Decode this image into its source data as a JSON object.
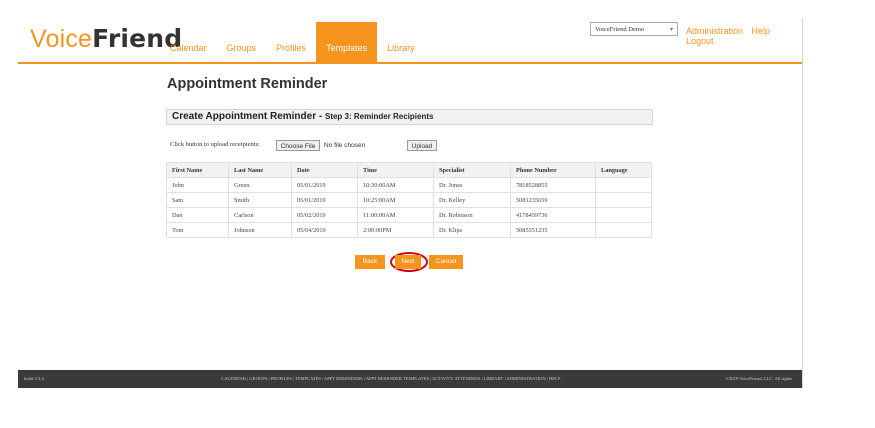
{
  "logo": {
    "voice": "Voice",
    "friend": "Friend"
  },
  "nav": {
    "tabs": [
      {
        "label": "Calendar",
        "active": false
      },
      {
        "label": "Groups",
        "active": false
      },
      {
        "label": "Profiles",
        "active": false
      },
      {
        "label": "Templates",
        "active": true
      },
      {
        "label": "Library",
        "active": false
      }
    ]
  },
  "account": {
    "selected": "VoiceFriend Demo"
  },
  "top_links": {
    "administration": "Administration",
    "help": "Help",
    "logout": "Logout"
  },
  "page": {
    "title": "Appointment Reminder"
  },
  "step": {
    "main": "Create Appointment Reminder - ",
    "sub": "Step 3: Reminder Recipients"
  },
  "upload": {
    "label": "Click button to upload receipients:",
    "choose_label": "Choose File",
    "file_status": "No file chosen",
    "upload_label": "Upload"
  },
  "table": {
    "headers": [
      "First Name",
      "Last Name",
      "Date",
      "Time",
      "Specialist",
      "Phone Number",
      "Language"
    ],
    "rows": [
      [
        "John",
        "Green",
        "05/01/2019",
        "10:30:00AM",
        "Dr. Jones",
        "7818528855",
        ""
      ],
      [
        "Sam",
        "Smith",
        "05/01/2019",
        "10:25:00AM",
        "Dr. Kelley",
        "5081235659",
        ""
      ],
      [
        "Dan",
        "Carlson",
        "05/02/2019",
        "11:00:00AM",
        "Dr. Robinson",
        "4178459736",
        ""
      ],
      [
        "Tom",
        "Johnson",
        "05/04/2019",
        "2:00:00PM",
        "Dr. Klips",
        "5085551235",
        ""
      ]
    ]
  },
  "buttons": {
    "back": "Back",
    "next": "Next",
    "cancel": "Cancel"
  },
  "footer": {
    "build": "build 3.3.4",
    "links": "CALENDAR | GROUPS | PROFILES | TEMPLATES | APPT REMINDERS | APPT REMINDER TEMPLATES | ACTIVITY ATTENDEES | LIBRARY | ADMINISTRATION | HELP",
    "copyright": "©2019 VoiceFriend, LLC. All rights"
  },
  "colors": {
    "brand_orange": "#f7941d",
    "highlight_ring": "#d0021b",
    "footer_bg": "#3a3a3a"
  }
}
